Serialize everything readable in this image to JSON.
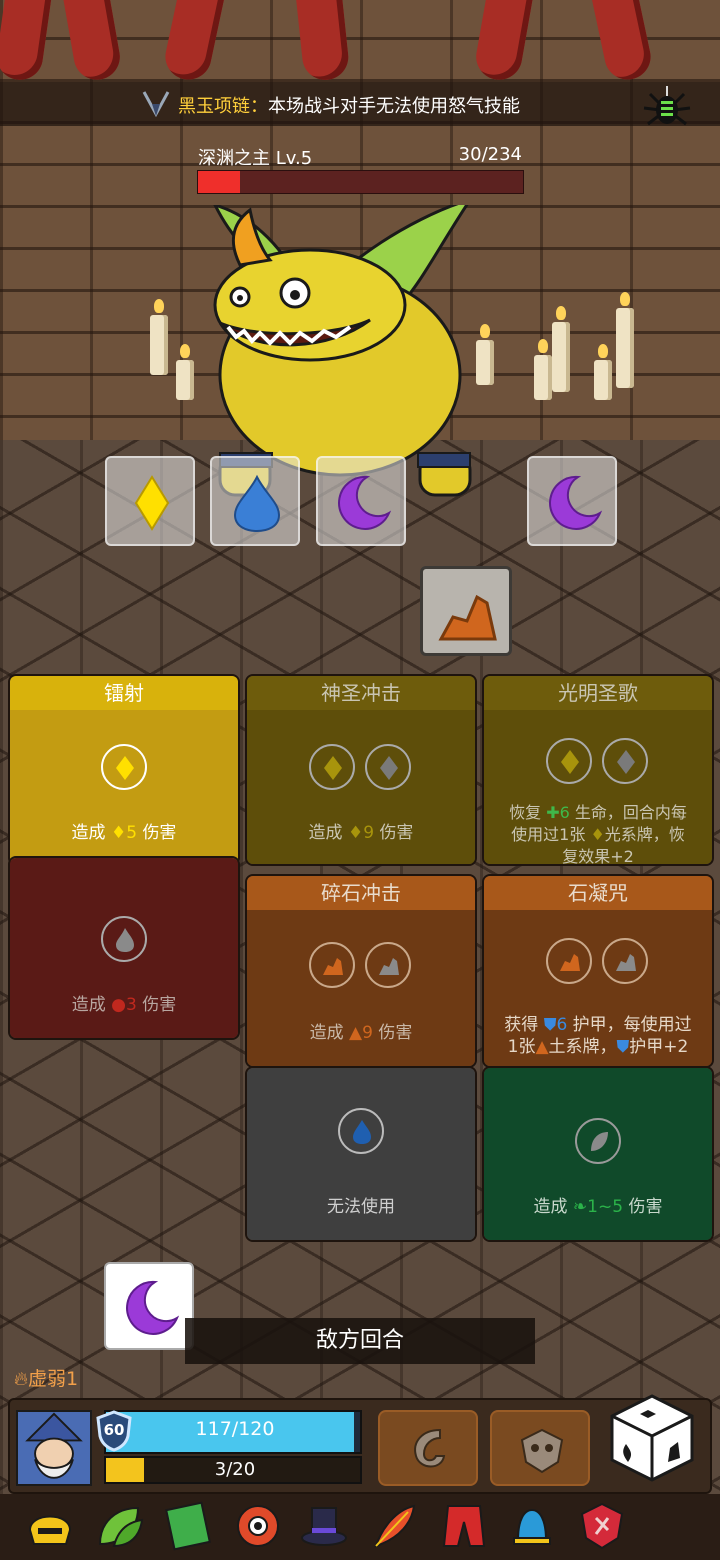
{
  "banner": {
    "relic_name": "黑玉项链：",
    "effect": "本场战斗对手无法使用怒气技能"
  },
  "boss": {
    "name": "深渊之主 Lv.5",
    "hp": "30/234",
    "hp_fraction": 0.128
  },
  "enemy_intents": [
    "light-diamond",
    "water-drop",
    "moon",
    "moon"
  ],
  "dice_slot_icon": "earth-rock",
  "cards": [
    {
      "title": "镭射",
      "desc_prefix": "造成",
      "desc_value": "5",
      "desc_suffix": "伤害"
    },
    {
      "title": "神圣冲击",
      "desc_prefix": "造成",
      "desc_value": "9",
      "desc_suffix": "伤害"
    },
    {
      "title": "光明圣歌",
      "desc_line1": "恢复 ",
      "heal": "6",
      "desc_line1b": " 生命，回合内每",
      "desc_line2": "使用过1张 ",
      "desc_line2b": "光系牌，恢",
      "desc_line3": "复效果+2"
    },
    {
      "title": "",
      "desc_prefix": "造成",
      "desc_value": "3",
      "desc_suffix": "伤害"
    },
    {
      "title": "碎石冲击",
      "desc_prefix": "造成",
      "desc_value": "9",
      "desc_suffix": "伤害"
    },
    {
      "title": "石凝咒",
      "desc_line1": "获得 ",
      "armor": "6",
      "desc_line1b": " 护甲，每使用过",
      "desc_line2": "1张",
      "desc_line2b": "土系牌，",
      "desc_line2c": "护甲+2"
    },
    {
      "title": "",
      "desc": "无法使用"
    },
    {
      "title": "",
      "desc_prefix": "造成",
      "desc_value": "1~5",
      "desc_suffix": "伤害"
    }
  ],
  "turn_label": "敌方回合",
  "held_die_icon": "moon",
  "status": {
    "label": "虚弱1"
  },
  "player": {
    "shield": "60",
    "hp": "117/120",
    "hp_fraction": 0.975,
    "energy": "3/20",
    "energy_fraction": 0.15
  },
  "skills": [
    "hook-skill-icon",
    "mask-skill-icon"
  ],
  "relics": [
    "helmet-icon",
    "leaves-icon",
    "spellbook-icon",
    "eye-sun-icon",
    "top-hat-icon",
    "feather-icon",
    "pants-icon",
    "bell-icon",
    "rune-shield-icon"
  ],
  "colors": {
    "light": "#ffe000",
    "fire": "#c0281e",
    "earth": "#d0661e",
    "water": "#1f5fb0",
    "wind": "#2bb34a",
    "moon": "#9b3ad8"
  }
}
